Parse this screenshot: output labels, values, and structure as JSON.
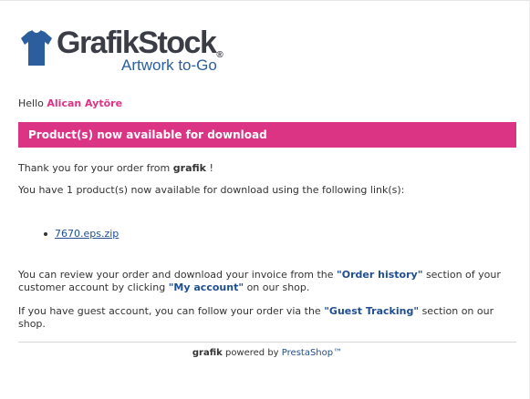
{
  "logo": {
    "brand": "GrafikStock",
    "registered": "®",
    "tagline": "Artwork to-Go"
  },
  "greeting": {
    "prefix": "Hello",
    "customer_name": "Alican Aytöre"
  },
  "banner": {
    "title": "Product(s) now available for download"
  },
  "body": {
    "thanks_prefix": "Thank you for your order from",
    "shop_name": "grafik",
    "thanks_suffix": "!",
    "download_count_text": "You have 1 product(s) now available for download using the following link(s):",
    "downloads": [
      "7670.eps.zip"
    ],
    "review": {
      "part1": "You can review your order and download your invoice from the",
      "order_history": "\"Order history\"",
      "part2": "section of your customer account by clicking",
      "my_account": "\"My account\"",
      "part3": "on our shop."
    },
    "guest": {
      "part1": "If you have guest account, you can follow your order via the",
      "guest_tracking": "\"Guest Tracking\"",
      "part2": "section on our shop."
    }
  },
  "footer": {
    "shop_name": "grafik",
    "powered_by": "powered by",
    "platform": "PrestaShop™"
  },
  "colors": {
    "accent": "#db3484",
    "link": "#1f4e91",
    "tagline": "#2c5e9e"
  }
}
